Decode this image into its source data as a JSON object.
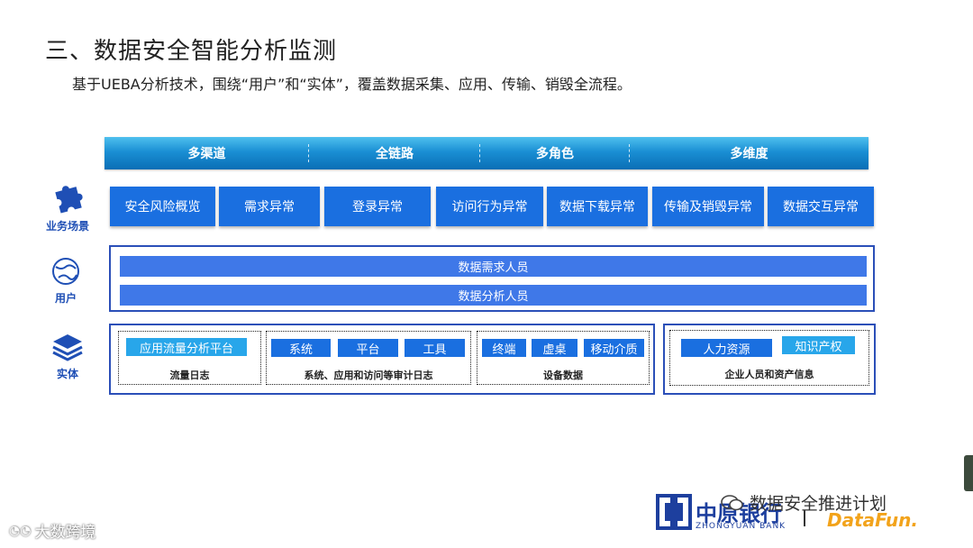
{
  "slide": {
    "title": "三、数据安全智能分析监测",
    "subtitle": "基于UEBA分析技术，围绕“用户”和“实体”，覆盖数据采集、应用、传输、销毁全流程。"
  },
  "banner": {
    "segments": [
      "多渠道",
      "全链路",
      "多角色",
      "多维度"
    ]
  },
  "sidebar": {
    "business_label": "业务场景",
    "user_label": "用户",
    "entity_label": "实体"
  },
  "scenarios": [
    "安全风险概览",
    "需求异常",
    "登录异常",
    "访问行为异常",
    "数据下载异常",
    "传输及销毁异常",
    "数据交互异常"
  ],
  "users": [
    "数据需求人员",
    "数据分析人员"
  ],
  "entities": {
    "traffic": {
      "buttons": [
        "应用流量分析平台"
      ],
      "caption": "流量日志"
    },
    "systems": {
      "buttons": [
        "系统",
        "平台",
        "工具"
      ],
      "caption": "系统、应用和访问等审计日志"
    },
    "devices": {
      "buttons": [
        "终端",
        "虚桌",
        "移动介质"
      ],
      "caption": "设备数据"
    },
    "enterprise": {
      "buttons": [
        "人力资源",
        "知识产权"
      ],
      "caption": "企业人员和资产信息"
    }
  },
  "footer": {
    "bank_logo_cn": "中原银行",
    "bank_logo_en": "ZHONGYUAN BANK",
    "wechat_watermark": "数据安全推进计划",
    "datafun": "DataFun.",
    "bottom_left_watermark": "大数跨境"
  },
  "colors": {
    "accent": "#1a6fe0",
    "banner": "#1a8fd4",
    "border": "#2b4fb8"
  }
}
